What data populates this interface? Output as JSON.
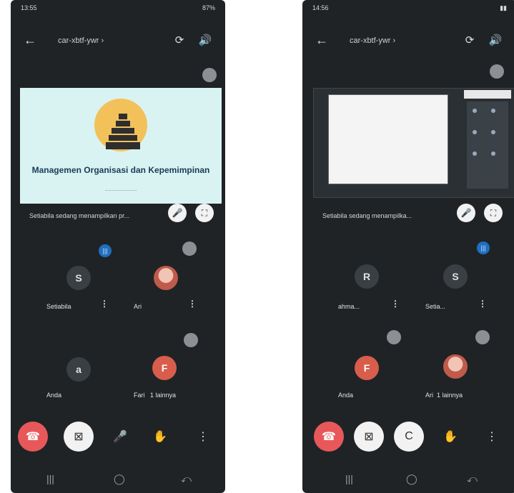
{
  "left": {
    "status_time": "13:55",
    "status_right": "87%",
    "meeting_code": "car-xbtf-ywr",
    "slide_title": "Managemen Organisasi dan Kepemimpinan",
    "slide_subtitle": "...........................",
    "presenting_label": "Setiabila sedang menampilkan pr...",
    "participants": [
      {
        "initial": "S",
        "name": "Setiabila"
      },
      {
        "initial": "",
        "name": "Ari"
      },
      {
        "initial": "a",
        "name": "Anda"
      },
      {
        "initial": "F",
        "name": "Fari",
        "extra": "1 lainnya"
      }
    ],
    "nav": {
      "recents": "|||",
      "home": "◯",
      "back": "⤺"
    }
  },
  "right": {
    "status_time": "14:56",
    "meeting_code": "car-xbtf-ywr",
    "presenting_label": "Setiabila sedang menampilka...",
    "participants": [
      {
        "initial": "R",
        "name": "ahma..."
      },
      {
        "initial": "S",
        "name": "Setia..."
      },
      {
        "initial": "F",
        "name": "Anda"
      },
      {
        "initial": "",
        "name": "Ari",
        "extra": "1 lainnya"
      }
    ],
    "nav": {
      "recents": "|||",
      "home": "◯",
      "back": "⤺"
    }
  },
  "icons": {
    "back": "←",
    "camera_switch": "⟳",
    "speaker": "🔊",
    "mic": "🎤",
    "fullscreen": "⛶",
    "end_call": "☎",
    "camera_off": "⊠",
    "hand": "✋",
    "more": "⋮",
    "captions": "C"
  },
  "colors": {
    "end_call": "#e8585a",
    "background": "#1f2326",
    "avatar_red": "#d95d4c",
    "slide_bg": "#d9f3f3",
    "audio_active": "#1f6fbf"
  }
}
